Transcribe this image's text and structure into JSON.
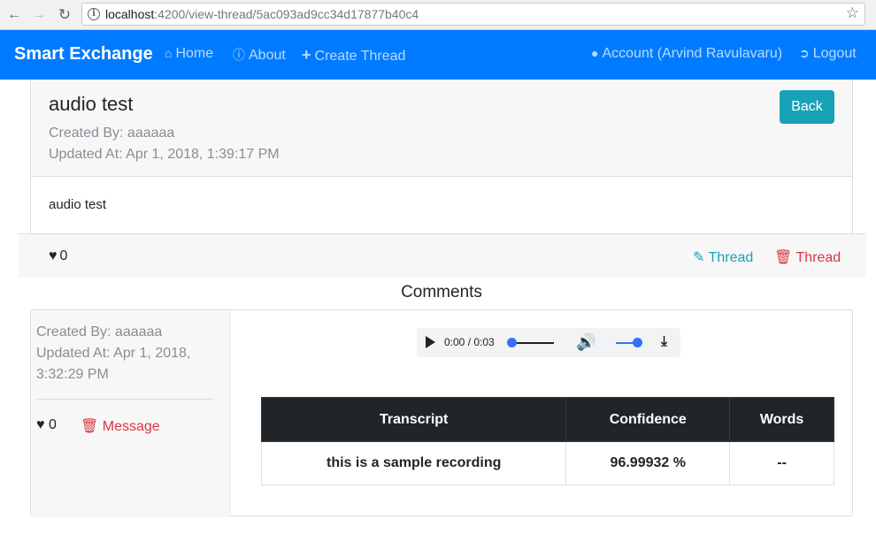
{
  "browser": {
    "url_host": "localhost",
    "url_path": ":4200/view-thread/5ac093ad9cc34d17877b40c4"
  },
  "navbar": {
    "brand": "Smart Exchange",
    "home": "Home",
    "about": "About",
    "create_thread": "Create Thread",
    "account": "Account (Arvind Ravulavaru)",
    "logout": "Logout"
  },
  "thread": {
    "title": "audio test",
    "created_by": "Created By: aaaaaa",
    "updated_at": "Updated At: Apr 1, 2018, 1:39:17 PM",
    "back_label": "Back",
    "body": "audio test",
    "likes": "0",
    "edit_label": "Thread",
    "delete_label": "Thread"
  },
  "comments": {
    "heading": "Comments",
    "items": [
      {
        "created_by": "Created By: aaaaaa",
        "updated_at": "Updated At: Apr 1, 2018, 3:32:29 PM",
        "likes": "0",
        "delete_label": "Message",
        "audio_time": "0:00 / 0:03",
        "table": {
          "headers": [
            "Transcript",
            "Confidence",
            "Words"
          ],
          "rows": [
            [
              "this is a sample recording",
              "96.99932 %",
              "--"
            ]
          ]
        }
      }
    ]
  },
  "colors": {
    "primary": "#007bff",
    "info": "#17a2b8",
    "danger": "#dc3545",
    "dark": "#212529"
  }
}
